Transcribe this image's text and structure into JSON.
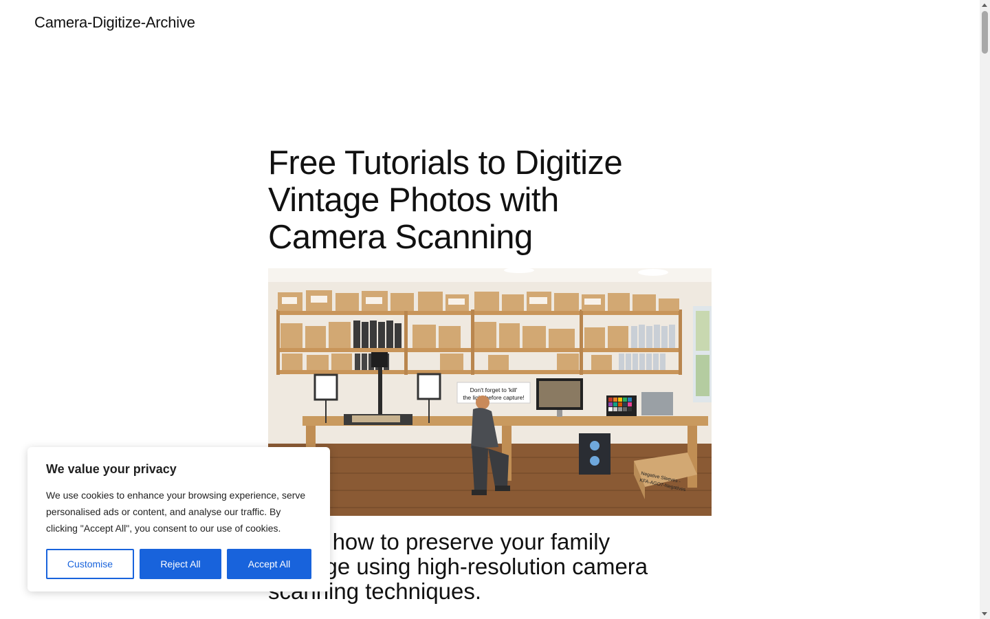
{
  "header": {
    "site_title": "Camera-Digitize-Archive"
  },
  "hero": {
    "title": "Free Tutorials to Digitize Vintage Photos with Camera Scanning",
    "subtitle": "Learn how to preserve your family heritage using high-resolution camera scanning techniques.",
    "image_sign_line1": "Don't forget to 'kill'",
    "image_sign_line2": "the light before capture!",
    "image_box_label_1": "Negative Sleeves -",
    "image_box_label_2": "KFA-AGO7-Negatives"
  },
  "cookie_banner": {
    "title": "We value your privacy",
    "text": "We use cookies to enhance your browsing experience, serve personalised ads or content, and analyse our traffic. By clicking \"Accept All\", you consent to our use of cookies.",
    "customise_label": "Customise",
    "reject_label": "Reject All",
    "accept_label": "Accept All",
    "accent_color": "#1863dc"
  }
}
